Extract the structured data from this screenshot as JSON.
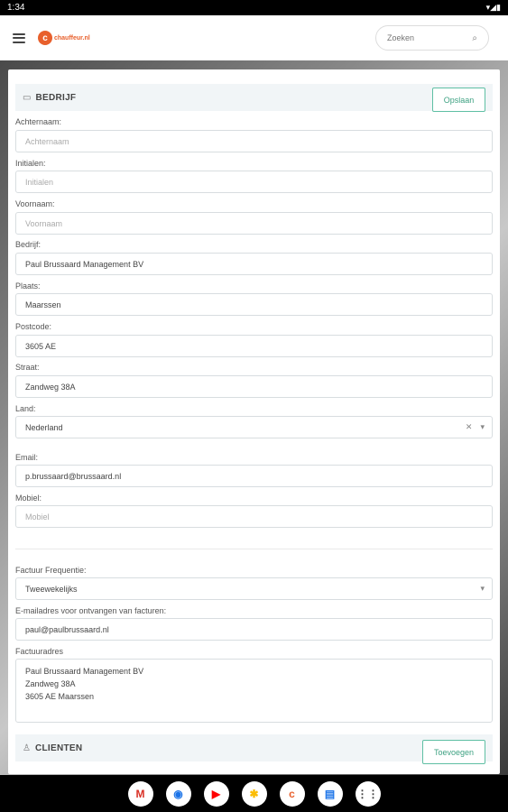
{
  "status": {
    "time": "1:34",
    "icons": "▾◢▮"
  },
  "header": {
    "logo_mark": "c",
    "logo_text": "chauffeur.nl",
    "search_placeholder": "Zoeken",
    "search_icon": "search-icon"
  },
  "section_bedrijf": {
    "title": "BEDRIJF",
    "icon": "briefcase-icon",
    "save_label": "Opslaan"
  },
  "fields": {
    "achternaam": {
      "label": "Achternaam:",
      "placeholder": "Achternaam",
      "value": ""
    },
    "initialen": {
      "label": "Initialen:",
      "placeholder": "Initialen",
      "value": ""
    },
    "voornaam": {
      "label": "Voornaam:",
      "placeholder": "Voornaam",
      "value": ""
    },
    "bedrijf": {
      "label": "Bedrijf:",
      "value": "Paul Brussaard Management BV"
    },
    "plaats": {
      "label": "Plaats:",
      "value": "Maarssen"
    },
    "postcode": {
      "label": "Postcode:",
      "value": "3605 AE"
    },
    "straat": {
      "label": "Straat:",
      "value": "Zandweg  38A"
    },
    "land": {
      "label": "Land:",
      "value": "Nederland"
    },
    "email": {
      "label": "Email:",
      "value": "p.brussaard@brussaard.nl"
    },
    "mobiel": {
      "label": "Mobiel:",
      "placeholder": "Mobiel",
      "value": ""
    },
    "factuur_frequentie": {
      "label": "Factuur Frequentie:",
      "value": "Tweewekelijks"
    },
    "factuur_email": {
      "label": "E-mailadres voor ontvangen van facturen:",
      "value": "paul@paulbrussaard.nl"
    },
    "factuuradres": {
      "label": "Factuuradres",
      "lines": [
        "Paul Brussaard Management BV",
        "Zandweg  38A",
        "3605 AE Maarssen"
      ]
    }
  },
  "section_clienten": {
    "title": "CLIENTEN",
    "icon": "user-icon",
    "add_label": "Toevoegen"
  },
  "nav_apps": [
    {
      "name": "gmail-app-icon",
      "glyph": "M",
      "color": "#d93025"
    },
    {
      "name": "chrome-app-icon",
      "glyph": "◉",
      "color": "#1a73e8"
    },
    {
      "name": "youtube-app-icon",
      "glyph": "▶",
      "color": "#ff0000"
    },
    {
      "name": "photos-app-icon",
      "glyph": "✱",
      "color": "#fbbc04"
    },
    {
      "name": "chauffeur-app-icon",
      "glyph": "c",
      "color": "#e8602c"
    },
    {
      "name": "messages-app-icon",
      "glyph": "▤",
      "color": "#1a73e8"
    },
    {
      "name": "app-drawer-icon",
      "glyph": "⋮⋮",
      "color": "#444"
    }
  ]
}
